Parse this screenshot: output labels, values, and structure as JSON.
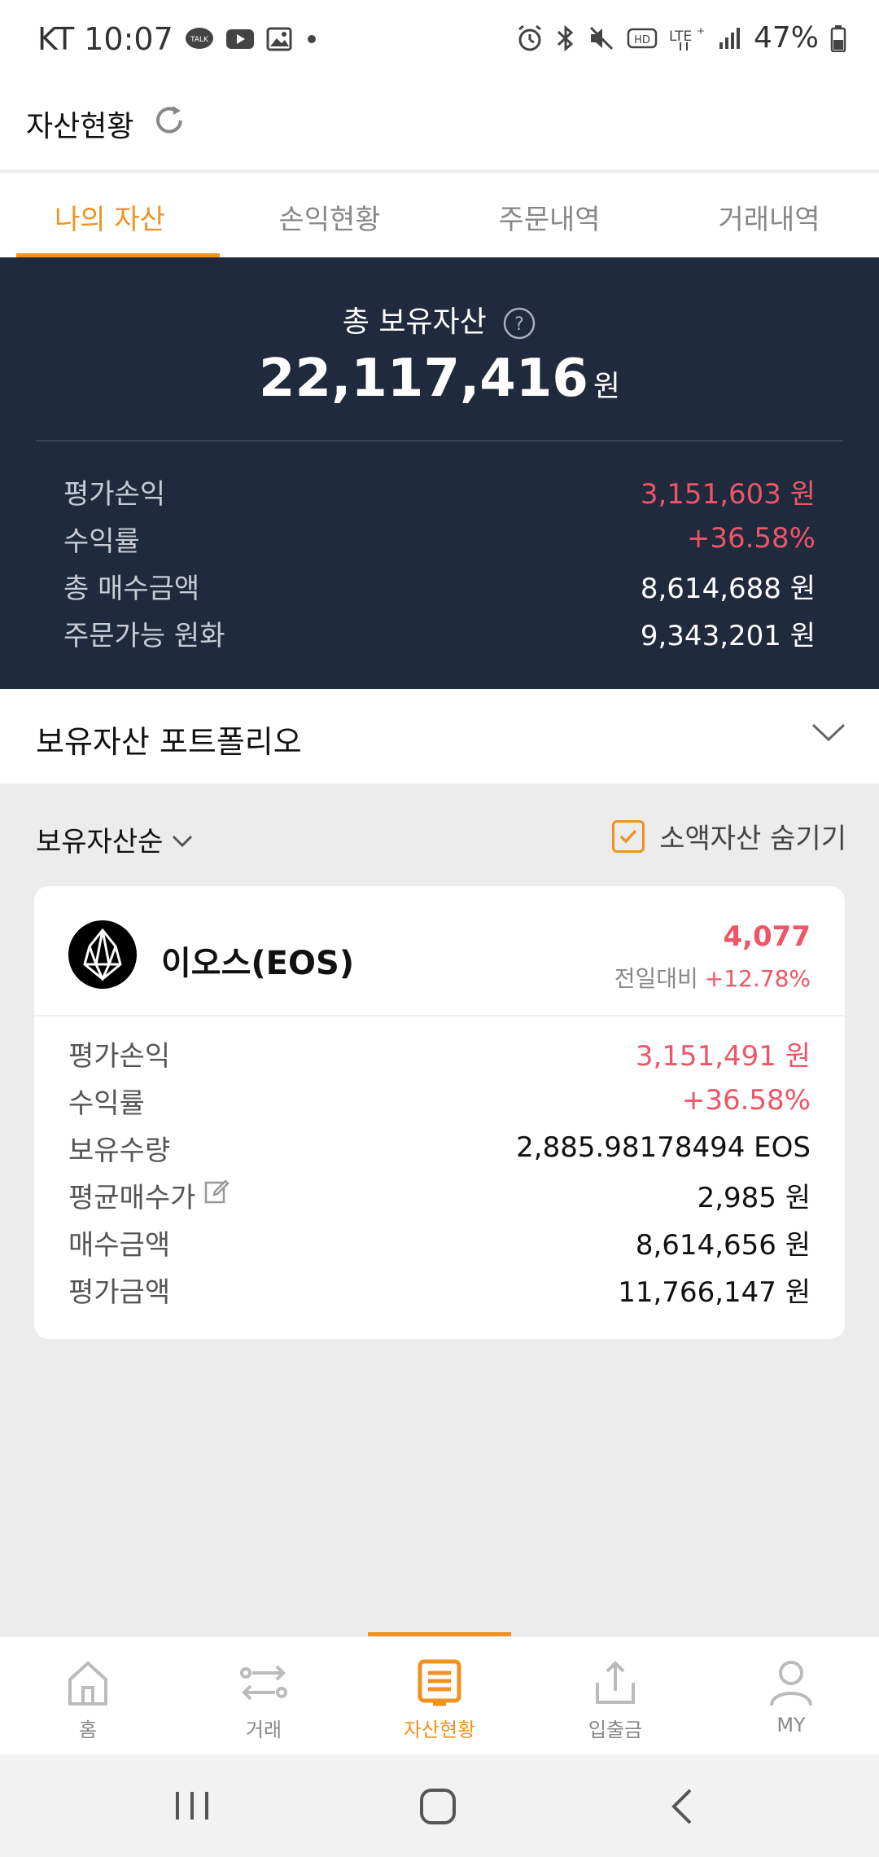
{
  "status_bar": {
    "time": "KT 10:07",
    "battery": "47%"
  },
  "header": {
    "title": "자산현황"
  },
  "tabs": [
    {
      "label": "나의 자산",
      "active": true
    },
    {
      "label": "손익현황",
      "active": false
    },
    {
      "label": "주문내역",
      "active": false
    },
    {
      "label": "거래내역",
      "active": false
    }
  ],
  "summary": {
    "title": "총 보유자산",
    "total": "22,117,416",
    "unit": "원",
    "rows": [
      {
        "label": "평가손익",
        "value": "3,151,603 원"
      },
      {
        "label": "수익률",
        "value": "+36.58%"
      },
      {
        "label": "총 매수금액",
        "value": "8,614,688 원"
      },
      {
        "label": "주문가능 원화",
        "value": "9,343,201 원"
      }
    ]
  },
  "portfolio": {
    "title": "보유자산 포트폴리오"
  },
  "sort": {
    "label": "보유자산순",
    "hide_small_label": "소액자산 숨기기",
    "hide_small_checked": true
  },
  "holding": {
    "name": "이오스(EOS)",
    "price": "4,077",
    "change_label": "전일대비",
    "change_value": "+12.78%",
    "rows": [
      {
        "label": "평가손익",
        "value": "3,151,491 원"
      },
      {
        "label": "수익률",
        "value": "+36.58%"
      },
      {
        "label": "보유수량",
        "value": "2,885.98178494 EOS"
      },
      {
        "label": "평균매수가",
        "value": "2,985 원"
      },
      {
        "label": "매수금액",
        "value": "8,614,656 원"
      },
      {
        "label": "평가금액",
        "value": "11,766,147 원"
      }
    ]
  },
  "bottom_nav": [
    {
      "label": "홈",
      "icon": "home-icon"
    },
    {
      "label": "거래",
      "icon": "exchange-icon"
    },
    {
      "label": "자산현황",
      "icon": "asset-icon",
      "active": true
    },
    {
      "label": "입출금",
      "icon": "deposit-icon"
    },
    {
      "label": "MY",
      "icon": "user-icon"
    }
  ],
  "colors": {
    "accent": "#f0921f",
    "navy": "#1f2a3c",
    "red": "#ee5567"
  }
}
